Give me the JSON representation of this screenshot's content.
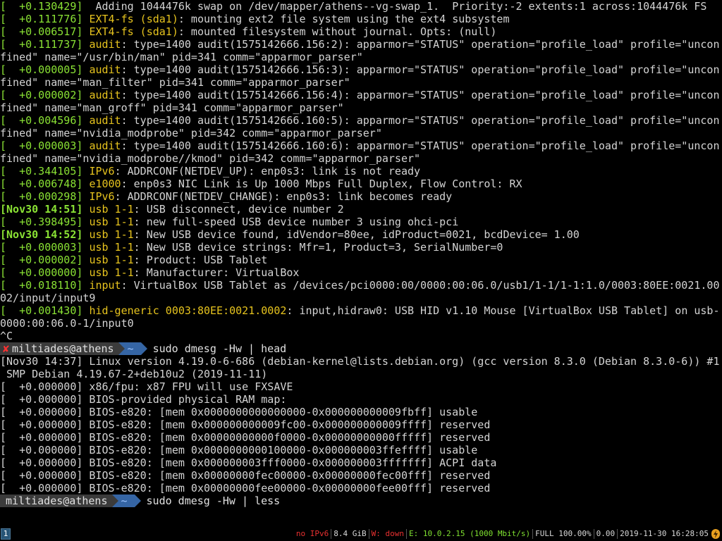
{
  "terminal": {
    "kernel_log": [
      {
        "ts": "[  +0.130429]",
        "fac": "",
        "msg": " Adding 1044476k swap on /dev/mapper/athens--vg-swap_1.  Priority:-2 extents:1 across:1044476k FS"
      },
      {
        "ts": "[  +0.111776]",
        "fac": "EXT4-fs (sda1)",
        "msg": ": mounting ext2 file system using the ext4 subsystem"
      },
      {
        "ts": "[  +0.006517]",
        "fac": "EXT4-fs (sda1)",
        "msg": ": mounted filesystem without journal. Opts: (null)"
      },
      {
        "ts": "[  +0.111737]",
        "fac": "audit",
        "msg": ": type=1400 audit(1575142666.156:2): apparmor=\"STATUS\" operation=\"profile_load\" profile=\"uncon"
      },
      {
        "ts": "",
        "fac": "",
        "msg": "fined\" name=\"/usr/bin/man\" pid=341 comm=\"apparmor_parser\""
      },
      {
        "ts": "[  +0.000005]",
        "fac": "audit",
        "msg": ": type=1400 audit(1575142666.156:3): apparmor=\"STATUS\" operation=\"profile_load\" profile=\"uncon"
      },
      {
        "ts": "",
        "fac": "",
        "msg": "fined\" name=\"man_filter\" pid=341 comm=\"apparmor_parser\""
      },
      {
        "ts": "[  +0.000002]",
        "fac": "audit",
        "msg": ": type=1400 audit(1575142666.156:4): apparmor=\"STATUS\" operation=\"profile_load\" profile=\"uncon"
      },
      {
        "ts": "",
        "fac": "",
        "msg": "fined\" name=\"man_groff\" pid=341 comm=\"apparmor_parser\""
      },
      {
        "ts": "[  +0.004596]",
        "fac": "audit",
        "msg": ": type=1400 audit(1575142666.160:5): apparmor=\"STATUS\" operation=\"profile_load\" profile=\"uncon"
      },
      {
        "ts": "",
        "fac": "",
        "msg": "fined\" name=\"nvidia_modprobe\" pid=342 comm=\"apparmor_parser\""
      },
      {
        "ts": "[  +0.000003]",
        "fac": "audit",
        "msg": ": type=1400 audit(1575142666.160:6): apparmor=\"STATUS\" operation=\"profile_load\" profile=\"uncon"
      },
      {
        "ts": "",
        "fac": "",
        "msg": "fined\" name=\"nvidia_modprobe//kmod\" pid=342 comm=\"apparmor_parser\""
      },
      {
        "ts": "[  +0.344105]",
        "fac": "IPv6",
        "msg": ": ADDRCONF(NETDEV_UP): enp0s3: link is not ready"
      },
      {
        "ts": "[  +0.006748]",
        "fac": "e1000",
        "msg": ": enp0s3 NIC Link is Up 1000 Mbps Full Duplex, Flow Control: RX"
      },
      {
        "ts": "[  +0.000298]",
        "fac": "IPv6",
        "msg": ": ADDRCONF(NETDEV_CHANGE): enp0s3: link becomes ready"
      },
      {
        "ts": "[Nov30 14:51]",
        "fac": "usb 1-1",
        "msg": ": USB disconnect, device number 2",
        "bold": true
      },
      {
        "ts": "[  +0.398495]",
        "fac": "usb 1-1",
        "msg": ": new full-speed USB device number 3 using ohci-pci"
      },
      {
        "ts": "[Nov30 14:52]",
        "fac": "usb 1-1",
        "msg": ": New USB device found, idVendor=80ee, idProduct=0021, bcdDevice= 1.00",
        "bold": true
      },
      {
        "ts": "[  +0.000003]",
        "fac": "usb 1-1",
        "msg": ": New USB device strings: Mfr=1, Product=3, SerialNumber=0"
      },
      {
        "ts": "[  +0.000002]",
        "fac": "usb 1-1",
        "msg": ": Product: USB Tablet"
      },
      {
        "ts": "[  +0.000000]",
        "fac": "usb 1-1",
        "msg": ": Manufacturer: VirtualBox"
      },
      {
        "ts": "[  +0.018110]",
        "fac": "input",
        "msg": ": VirtualBox USB Tablet as /devices/pci0000:00/0000:00:06.0/usb1/1-1/1-1:1.0/0003:80EE:0021.00"
      },
      {
        "ts": "",
        "fac": "",
        "msg": "02/input/input9"
      },
      {
        "ts": "[  +0.001430]",
        "fac": "hid-generic 0003:80EE:0021.0002",
        "msg": ": input,hidraw0: USB HID v1.10 Mouse [VirtualBox USB Tablet] on usb-"
      },
      {
        "ts": "",
        "fac": "",
        "msg": "0000:00:06.0-1/input0"
      },
      {
        "ts": "",
        "fac": "",
        "msg": "^C"
      }
    ],
    "prompt1": {
      "error_mark": "✘",
      "user_host": "miltiades@athens",
      "dir": "~",
      "command": "sudo dmesg -Hw | head"
    },
    "head_output": [
      "[Nov30 14:37] Linux version 4.19.0-6-686 (debian-kernel@lists.debian.org) (gcc version 8.3.0 (Debian 8.3.0-6)) #1",
      " SMP Debian 4.19.67-2+deb10u2 (2019-11-11)",
      "[  +0.000000] x86/fpu: x87 FPU will use FXSAVE",
      "[  +0.000000] BIOS-provided physical RAM map:",
      "[  +0.000000] BIOS-e820: [mem 0x0000000000000000-0x000000000009fbff] usable",
      "[  +0.000000] BIOS-e820: [mem 0x000000000009fc00-0x000000000009ffff] reserved",
      "[  +0.000000] BIOS-e820: [mem 0x00000000000f0000-0x00000000000fffff] reserved",
      "[  +0.000000] BIOS-e820: [mem 0x0000000000100000-0x000000003ffeffff] usable",
      "[  +0.000000] BIOS-e820: [mem 0x000000003fff0000-0x000000003fffffff] ACPI data",
      "[  +0.000000] BIOS-e820: [mem 0x00000000fec00000-0x00000000fec00fff] reserved",
      "[  +0.000000] BIOS-e820: [mem 0x00000000fee00000-0x00000000fee00fff] reserved"
    ],
    "prompt2": {
      "user_host": "miltiades@athens",
      "dir": "~",
      "command": "sudo dmesg -Hw | less"
    }
  },
  "statusbar": {
    "workspace": "1",
    "ipv6": "no IPv6",
    "memory": "8.4 GiB",
    "wifi": "W: down",
    "ethernet": "E: 10.0.2.15 (1000 Mbit/s)",
    "battery": "FULL 100.00%",
    "load": "0.00",
    "datetime": "2019-11-30 16:28:05",
    "colors": {
      "ipv6": "#e83030",
      "memory": "#d8d8d8",
      "wifi": "#e83030",
      "ethernet": "#7fe030",
      "battery": "#d8d8d8",
      "load": "#d8d8d8",
      "datetime": "#d8d8d8"
    }
  }
}
